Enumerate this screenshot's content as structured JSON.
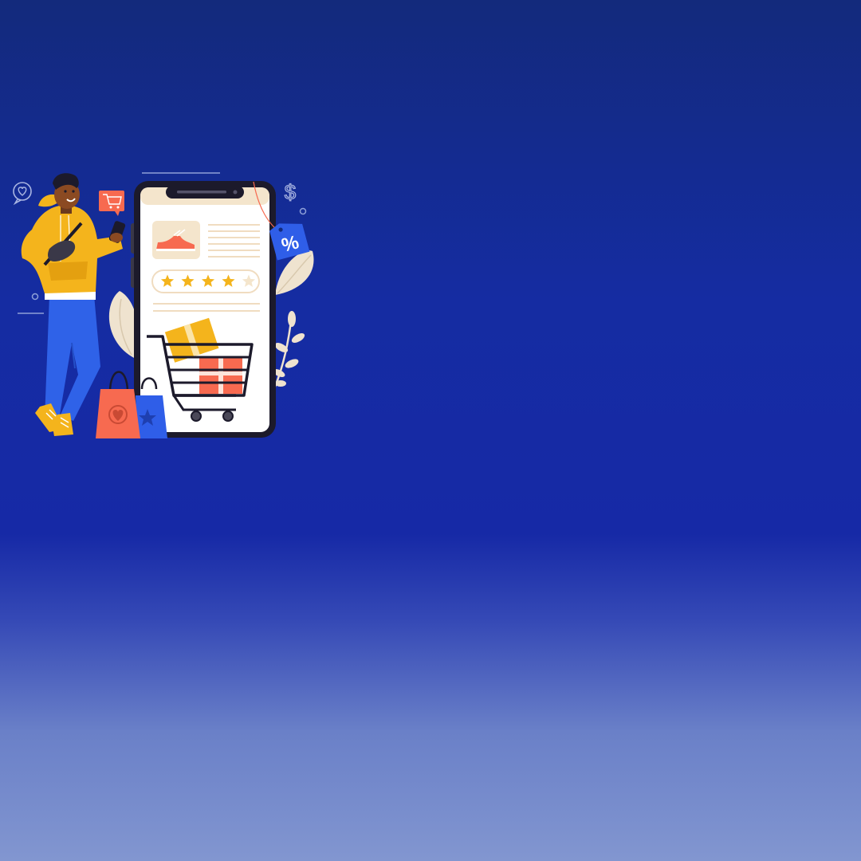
{
  "illustration": {
    "percent_tag": "%",
    "currency_symbol": "$",
    "rating": {
      "filled": 4,
      "total": 5
    }
  },
  "colors": {
    "background_top": "#132a7c",
    "background_mid": "#1629a6",
    "background_bottom": "#8296d0",
    "hoodie": "#f4b41c",
    "jeans": "#2f62e8",
    "phone_frame": "#1c1a2b",
    "phone_screen": "#ffffff",
    "accent_orange": "#f76a50",
    "accent_blue": "#2f5ee8",
    "star": "#f4b41c",
    "leaf": "#efe3cf"
  }
}
